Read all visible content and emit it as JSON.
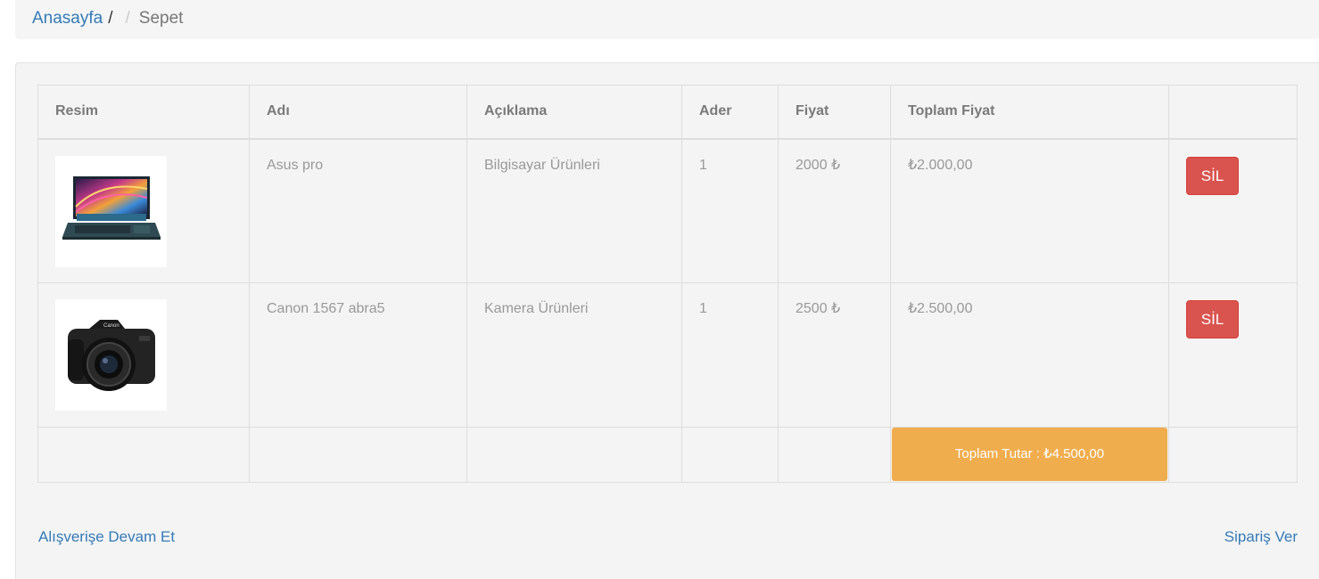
{
  "breadcrumb": {
    "home": "Anasayfa",
    "current": "Sepet"
  },
  "table": {
    "headers": [
      "Resim",
      "Adı",
      "Açıklama",
      "Ader",
      "Fiyat",
      "Toplam Fiyat",
      ""
    ],
    "rows": [
      {
        "image": "laptop-image",
        "name": "Asus pro",
        "description": "Bilgisayar Ürünleri",
        "qty": "1",
        "price": "2000 ₺",
        "total": "₺2.000,00",
        "delete_label": "SİL"
      },
      {
        "image": "camera-image",
        "name": "Canon 1567 abra5",
        "description": "Kamera Ürünleri",
        "qty": "1",
        "price": "2500 ₺",
        "total": "₺2.500,00",
        "delete_label": "SİL"
      }
    ],
    "grand_total": "Toplam Tutar : ₺4.500,00"
  },
  "footer": {
    "continue_label": "Alışverişe Devam Et",
    "order_label": "Sipariş Ver"
  },
  "colors": {
    "link": "#337ab7",
    "danger": "#d9534f",
    "warning": "#f0ad4e",
    "panel": "#f4f4f4"
  }
}
